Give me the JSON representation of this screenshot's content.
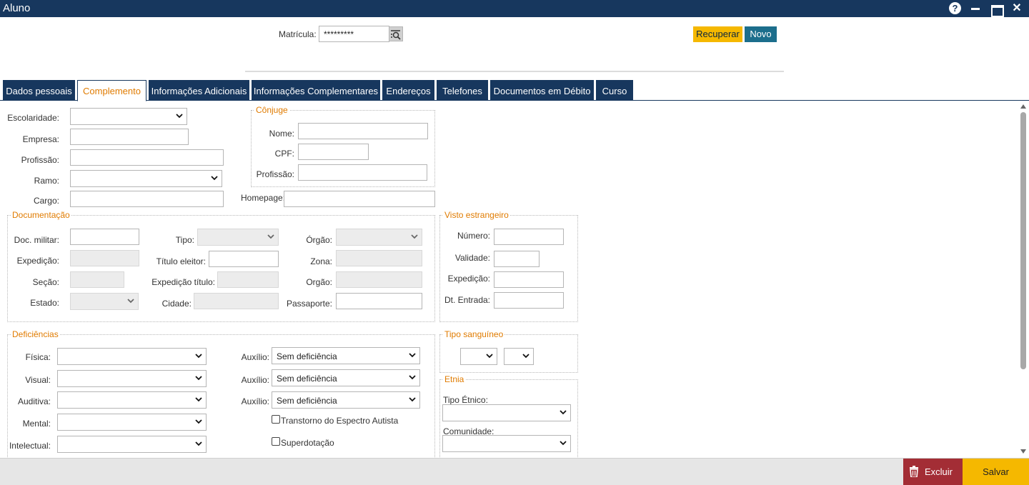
{
  "window": {
    "title": "Aluno",
    "help_glyph": "?",
    "close_glyph": "✕"
  },
  "header": {
    "matricula_label": "Matrícula:",
    "matricula_value": "*********",
    "recuperar_label": "Recuperar",
    "novo_label": "Novo"
  },
  "tabs": [
    {
      "label": "Dados pessoais",
      "active": false
    },
    {
      "label": "Complemento",
      "active": true
    },
    {
      "label": "Informações Adicionais",
      "active": false
    },
    {
      "label": "Informações Complementares",
      "active": false
    },
    {
      "label": "Endereços",
      "active": false
    },
    {
      "label": "Telefones",
      "active": false
    },
    {
      "label": "Documentos em Débito",
      "active": false
    },
    {
      "label": "Curso",
      "active": false
    }
  ],
  "main": {
    "escolaridade_label": "Escolaridade:",
    "empresa_label": "Empresa:",
    "profissao_label": "Profissão:",
    "ramo_label": "Ramo:",
    "cargo_label": "Cargo:",
    "homepage_label": "Homepage:"
  },
  "conjuge": {
    "legend": "Cônjuge",
    "nome_label": "Nome:",
    "cpf_label": "CPF:",
    "profissao_label": "Profissão:"
  },
  "documentacao": {
    "legend": "Documentação",
    "doc_militar_label": "Doc. militar:",
    "expedicao_label": "Expedição:",
    "secao_label": "Seção:",
    "estado_label": "Estado:",
    "tipo_label": "Tipo:",
    "titulo_eleitor_label": "Título eleitor:",
    "expedicao_titulo_label": "Expedição título:",
    "cidade_label": "Cidade:",
    "orgao1_label": "Órgão:",
    "zona_label": "Zona:",
    "orgao2_label": "Orgão:",
    "passaporte_label": "Passaporte:"
  },
  "visto": {
    "legend": "Visto estrangeiro",
    "numero_label": "Número:",
    "validade_label": "Validade:",
    "expedicao_label": "Expedição:",
    "dt_entrada_label": "Dt. Entrada:"
  },
  "deficiencias": {
    "legend": "Deficiências",
    "fisica_label": "Física:",
    "visual_label": "Visual:",
    "auditiva_label": "Auditiva:",
    "mental_label": "Mental:",
    "intelectual_label": "Intelectual:",
    "auxilio_label": "Auxílio:",
    "auxilio_value": "Sem deficiência",
    "tea_label": "Transtorno do Espectro Autista",
    "superdotacao_label": "Superdotação"
  },
  "tipo_sanguineo": {
    "legend": "Tipo sanguíneo"
  },
  "etnia": {
    "legend": "Etnia",
    "tipo_etnico_label": "Tipo Étnico:",
    "comunidade_label": "Comunidade:"
  },
  "footer": {
    "excluir_label": "Excluir",
    "salvar_label": "Salvar"
  },
  "colors": {
    "titlebar": "#17375e",
    "accent_orange": "#e07b00",
    "recuperar_bg": "#f5b800",
    "novo_bg": "#1c6e8c",
    "excluir_bg": "#a32d35",
    "salvar_bg": "#f5b800"
  },
  "icons": {
    "help": "help-icon",
    "minimize": "minimize-icon",
    "maximize": "maximize-icon",
    "close": "close-icon",
    "search": "search-list-icon",
    "select": "chevron-down-icon",
    "delete": "trash-icon"
  }
}
